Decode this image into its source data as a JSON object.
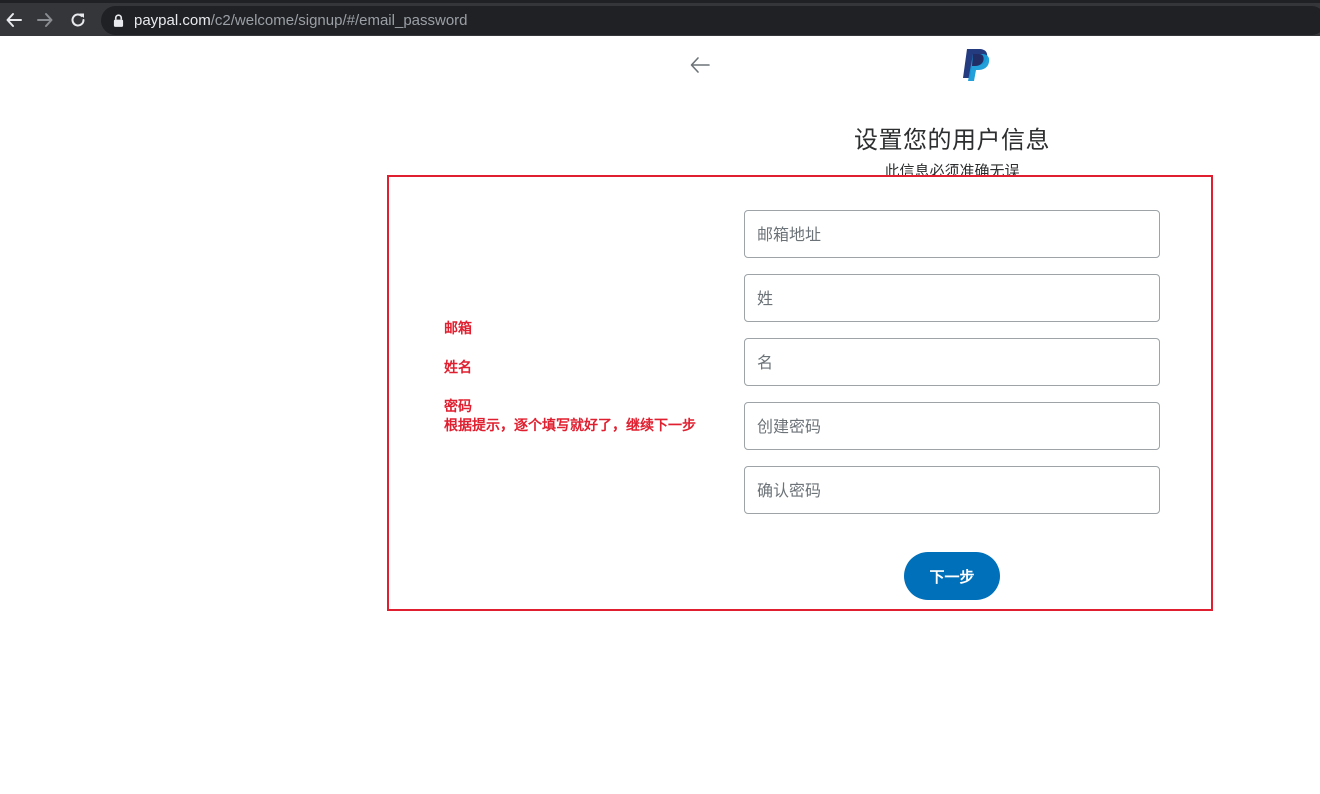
{
  "browser": {
    "url_domain": "paypal.com",
    "url_path": "/c2/welcome/signup/#/email_password",
    "icons": [
      "back-icon",
      "forward-icon",
      "reload-icon",
      "lock-icon"
    ]
  },
  "header": {
    "back_icon": "arrow-left-icon",
    "logo": "paypal-logo"
  },
  "page": {
    "title": "设置您的用户信息",
    "subtitle": "此信息必须准确无误"
  },
  "annotation": {
    "email": "邮箱",
    "name": "姓名",
    "password": "密码",
    "instruction": "根据提示，逐个填写就好了，继续下一步",
    "color": "#e02030"
  },
  "form": {
    "email_placeholder": "邮箱地址",
    "last_name_placeholder": "姓",
    "first_name_placeholder": "名",
    "password_placeholder": "创建密码",
    "confirm_password_placeholder": "确认密码",
    "next_label": "下一步"
  },
  "colors": {
    "primary_button": "#0070ba",
    "paypal_dark": "#253b80",
    "paypal_light": "#179bd7"
  }
}
